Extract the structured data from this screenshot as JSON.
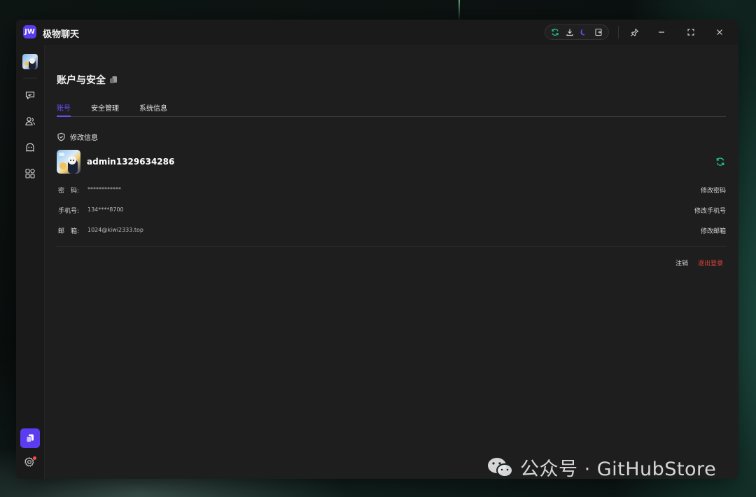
{
  "app": {
    "logo_text": "JW",
    "title": "极物聊天"
  },
  "page": {
    "title": "账户与安全",
    "tabs": [
      {
        "label": "账号",
        "active": true
      },
      {
        "label": "安全管理",
        "active": false
      },
      {
        "label": "系统信息",
        "active": false
      }
    ],
    "section_title": "修改信息",
    "username": "admin1329634286",
    "rows": [
      {
        "label": "密　码:",
        "value": "************",
        "action": "修改密码"
      },
      {
        "label": "手机号:",
        "value": "134****8700",
        "action": "修改手机号"
      },
      {
        "label": "邮　箱:",
        "value": "1024@kiwi2333.top",
        "action": "修改邮箱"
      }
    ],
    "cancel_account": "注销",
    "logout": "退出登录"
  },
  "watermark": {
    "text": "公众号 · GitHubStore"
  },
  "colors": {
    "accent": "#5b3cf0",
    "danger": "#e0433c",
    "success": "#22c38e",
    "background": "#1e1e1e"
  },
  "icons": [
    "refresh-icon",
    "download-icon",
    "moon-icon",
    "exit-icon",
    "pin-icon",
    "minimize-icon",
    "maximize-icon",
    "close-icon",
    "chat-icon",
    "contacts-icon",
    "ai-bot-icon",
    "apps-icon",
    "settings-gear-icon",
    "shield-check-icon",
    "copy-icon",
    "wechat-icon"
  ]
}
